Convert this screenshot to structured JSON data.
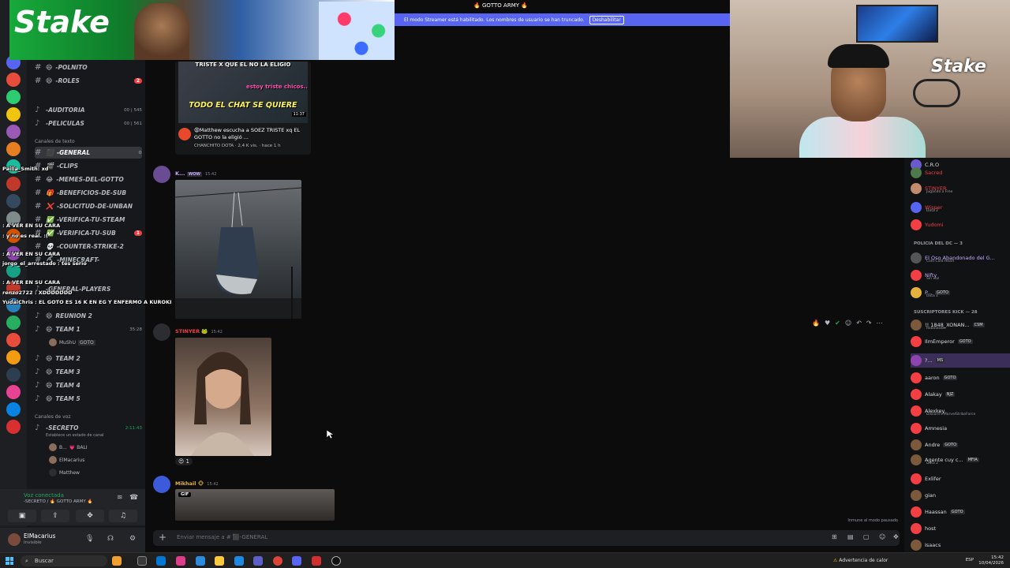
{
  "stream_banner": {
    "text": "El modo Streamer está habilitado. Los nombres de usuario se han truncado.",
    "button": "Deshabilitar"
  },
  "server_title": "🔥 GOTTO ARMY 🔥",
  "ad": {
    "logo": "Stake"
  },
  "webcam": {
    "brand": "Stake"
  },
  "sidebar": {
    "channels": [
      {
        "emoji": "😄",
        "label": "-POLNITO",
        "badge": ""
      },
      {
        "emoji": "😄",
        "label": "-ROLES",
        "badge": "2"
      },
      {
        "emoji": "🔈",
        "label": "-AUDITORIA",
        "count": "00 | 545"
      },
      {
        "emoji": "🔈",
        "label": "-PELICULAS",
        "count": "00 | 561"
      }
    ],
    "text_category": "Canales de texto",
    "text_channels": [
      {
        "emoji": "⬛",
        "label": "-GENERAL",
        "active": true
      },
      {
        "emoji": "🎬",
        "label": "-CLIPS"
      },
      {
        "emoji": "😂",
        "label": "-MEMES-DEL-GOTTO"
      },
      {
        "emoji": "🎁",
        "label": "-BENEFICIOS-DE-SUB"
      },
      {
        "emoji": "❌",
        "label": "-SOLICITUD-DE-UNBAN"
      },
      {
        "emoji": "✅",
        "label": "-VERIFICA-TU-STEAM"
      },
      {
        "emoji": "✅",
        "label": "-VERIFICA-TU-SUB",
        "badge": "1"
      },
      {
        "emoji": "💀",
        "label": "-COUNTER-STRIKE-2"
      },
      {
        "emoji": "⛏",
        "label": "-MINECRAFT-"
      }
    ],
    "voice_channels": [
      {
        "emoji": "🔊",
        "label": "-GENERAL-PLAYERS"
      },
      {
        "emoji": "😄",
        "label": "REUNION 2"
      },
      {
        "emoji": "😄",
        "label": "TEAM 1",
        "count": "35:28"
      },
      {
        "emoji": "😄",
        "label": "TEAM 2"
      },
      {
        "emoji": "😄",
        "label": "TEAM 3"
      },
      {
        "emoji": "😄",
        "label": "TEAM 4"
      },
      {
        "emoji": "😄",
        "label": "TEAM 5"
      }
    ],
    "team1_user": {
      "name": "MuShU",
      "tag": "GOTO"
    },
    "voice_category": "Canales de voz",
    "secret_channel": {
      "label": "-SECRETO",
      "count": "2:11:43",
      "status": "Establece un estado de canal"
    },
    "secret_users": [
      {
        "name": "B...",
        "tag": "💗 BALI"
      },
      {
        "name": "ElMacarius",
        "tag": ""
      },
      {
        "name": "Matthew",
        "tag": ""
      }
    ],
    "voice_connected": "Voz conectada",
    "voice_location": "-SECRETO / 🔥 GOTTO ARMY 🔥",
    "user": {
      "name": "ElMacarius",
      "status": "Invisible"
    }
  },
  "overlay_chat": [
    {
      "text": "Pailla_Smith: xd"
    },
    {
      "text": ": A VER EN SU CARA"
    },
    {
      "text": ": y no es real. :( "
    },
    {
      "text": ": A VER EN SU CARA"
    },
    {
      "text": "jorgo_el_arrestado : tes serio"
    },
    {
      "text": ": A VER EN SU CARA"
    },
    {
      "text": "renzo2722 : XDDDDDDD"
    },
    {
      "text": "YudaiChris : EL GOTO ES 16 K EN EG Y ENFERMO A KUROKI"
    }
  ],
  "messages": {
    "embed": {
      "thumb_top": "TRISTE X QUE EL NO LA ELIGIO",
      "thumb_mid": "estoy triste chicos..",
      "thumb_text": "TODO EL CHAT SE QUIERE",
      "duration": "11:37",
      "title": "😩Matthew escucha a SOEZ TRISTE xq EL GOTTO no la eligió ...",
      "meta": "CHANCHITO DOTA · 2,4 K vis. · hace 1 h"
    },
    "msg1": {
      "author": "K...",
      "tag": "WOW",
      "time": "15:42"
    },
    "msg2": {
      "author": "STINYER",
      "tag": "🐸",
      "time": "15:42"
    },
    "reaction": {
      "emoji": "😍",
      "count": "1"
    },
    "msg3": {
      "author": "Mikhail",
      "tag": "🐵",
      "time": "15:42",
      "media_tag": "GIF"
    }
  },
  "input": {
    "placeholder": "Enviar mensaje a # ⬛-GENERAL"
  },
  "paused_note": "Inmune al modo pausado",
  "members": {
    "rows_top": [
      {
        "name": "C.R.O",
        "sub": "",
        "color": "#dbdee1",
        "av": "#6a5acd"
      },
      {
        "name": "Sacred",
        "sub": "",
        "color": "#f23f43",
        "av": "#4c7a4a"
      },
      {
        "name": "STINYER",
        "sub": "Jugando a Free",
        "color": "#f23f43",
        "av": "#c38b6d"
      },
      {
        "name": "Wisper",
        "sub": "Dota 2",
        "color": "#f23f43",
        "av": "#5865f2"
      },
      {
        "name": "Yudomi",
        "sub": "",
        "color": "#f23f43",
        "av": "#f23f43"
      }
    ],
    "category_police": "POLICIA DEL DC — 3",
    "police": [
      {
        "name": "El Oso Abandonado del G...",
        "sub": "Cold Cold Heart",
        "color": "#c6a7ff",
        "av": "#555"
      },
      {
        "name": "Nifty",
        "sub": "Sin voz",
        "color": "#c6a7ff",
        "av": "#f23f43"
      },
      {
        "name": "P...",
        "tag": "GOTO",
        "sub": "Dota 2",
        "color": "#c6a7ff",
        "av": "#e5b33b"
      }
    ],
    "category_subs": "SUSCRIPTORES KICK — 28",
    "subs": [
      {
        "name": "!! 1848_XONAN...",
        "tag": "CSM",
        "sub": "RoboStakk",
        "color": "#dbdee1",
        "av": "#7a5a3a"
      },
      {
        "name": "IlmEmperor",
        "tag": "GOTO",
        "sub": "",
        "color": "#dbdee1",
        "av": "#f23f43"
      },
      {
        "name": "?...",
        "tag": "MS",
        "sub": "",
        "color": "#dbdee1",
        "av": "#8e44ad"
      },
      {
        "name": "aaron",
        "tag": "GOTO",
        "sub": "",
        "color": "#dbdee1",
        "av": "#f23f43"
      },
      {
        "name": "Alakay",
        "tag": "NJZ",
        "sub": "",
        "color": "#dbdee1",
        "av": "#f23f43"
      },
      {
        "name": "Alexkey",
        "tag": "",
        "sub": "Discord's MarvelStrikeForce",
        "color": "#dbdee1",
        "av": "#f23f43"
      },
      {
        "name": "Amnesia",
        "tag": "",
        "sub": "",
        "color": "#dbdee1",
        "av": "#f23f43"
      },
      {
        "name": "Andre",
        "tag": "GOTO",
        "sub": "",
        "color": "#dbdee1",
        "av": "#7a5a3a"
      },
      {
        "name": "Agente cuy c...",
        "tag": "MFIA",
        "sub": "Dota 2",
        "color": "#dbdee1",
        "av": "#7a5a3a"
      },
      {
        "name": "Exlifer",
        "tag": "",
        "sub": "",
        "color": "#dbdee1",
        "av": "#f23f43"
      },
      {
        "name": "gian",
        "tag": "",
        "sub": "",
        "color": "#dbdee1",
        "av": "#7a5a3a"
      },
      {
        "name": "Haassan",
        "tag": "GOTO",
        "sub": "",
        "color": "#dbdee1",
        "av": "#f23f43"
      },
      {
        "name": "host",
        "tag": "",
        "sub": "",
        "color": "#dbdee1",
        "av": "#f23f43"
      },
      {
        "name": "Isaacs",
        "tag": "",
        "sub": "",
        "color": "#dbdee1",
        "av": "#7a5a3a"
      }
    ]
  },
  "taskbar": {
    "search": "Buscar",
    "weather": "Advertencia de calor",
    "time": "15:42",
    "date": "10/04/2026",
    "lang": "ESP"
  }
}
